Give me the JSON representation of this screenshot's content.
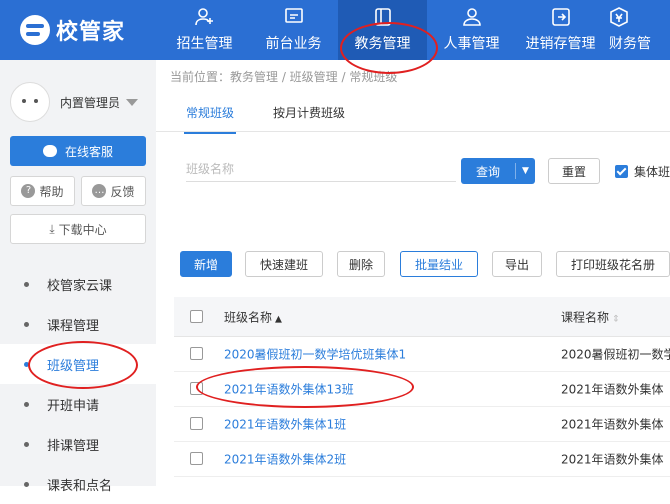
{
  "brand": {
    "name": "校管家"
  },
  "nav": [
    {
      "label": "招生管理",
      "icon": "user-plus-icon"
    },
    {
      "label": "前台业务",
      "icon": "monitor-icon"
    },
    {
      "label": "教务管理",
      "icon": "book-icon",
      "active": true
    },
    {
      "label": "人事管理",
      "icon": "person-icon"
    },
    {
      "label": "进销存管理",
      "icon": "box-arrow-icon"
    },
    {
      "label": "财务管",
      "icon": "yen-icon"
    }
  ],
  "user": {
    "name": "内置管理员"
  },
  "sidebar": {
    "service": "在线客服",
    "help": "帮助",
    "feedback": "反馈",
    "download": "下载中心",
    "menu": [
      "校管家云课",
      "课程管理",
      "班级管理",
      "开班申请",
      "排课管理",
      "课表和点名"
    ]
  },
  "breadcrumb": "当前位置：教务管理 / 班级管理 / 常规班级",
  "tabs": [
    "常规班级",
    "按月计费班级"
  ],
  "filter": {
    "placeholder": "班级名称",
    "query": "查询",
    "reset": "重置",
    "checkbox": "集体班"
  },
  "toolbar": [
    "新增",
    "快速建班",
    "删除",
    "批量结业",
    "导出",
    "打印班级花名册"
  ],
  "table": {
    "headers": [
      "班级名称",
      "课程名称"
    ],
    "rows": [
      [
        "2020暑假班初一数学培优班集体1",
        "2020暑假班初一数学"
      ],
      [
        "2021年语数外集体13班",
        "2021年语数外集体"
      ],
      [
        "2021年语数外集体1班",
        "2021年语数外集体"
      ],
      [
        "2021年语数外集体2班",
        "2021年语数外集体"
      ]
    ]
  },
  "colors": {
    "primary": "#2b6fd3",
    "accent": "#2b7ddb",
    "annotation": "#e02020"
  }
}
